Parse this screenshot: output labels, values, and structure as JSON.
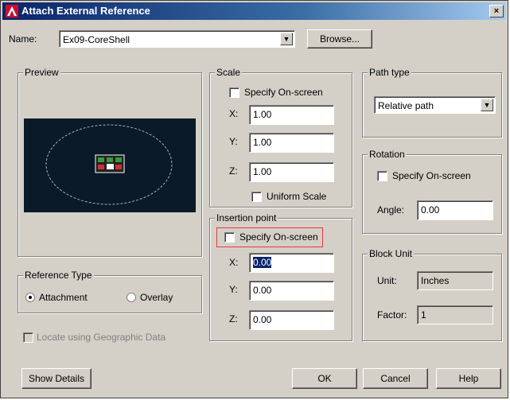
{
  "window": {
    "title": "Attach External Reference",
    "close_label": "×"
  },
  "name_row": {
    "label": "Name:",
    "value": "Ex09-CoreShell",
    "browse_label": "Browse..."
  },
  "preview": {
    "title": "Preview"
  },
  "scale": {
    "title": "Scale",
    "specify_label": "Specify On-screen",
    "x_label": "X:",
    "x_value": "1.00",
    "y_label": "Y:",
    "y_value": "1.00",
    "z_label": "Z:",
    "z_value": "1.00",
    "uniform_label": "Uniform Scale"
  },
  "insertion": {
    "title": "Insertion point",
    "specify_label": "Specify On-screen",
    "x_label": "X:",
    "x_value": "0.00",
    "y_label": "Y:",
    "y_value": "0.00",
    "z_label": "Z:",
    "z_value": "0.00"
  },
  "path_type": {
    "title": "Path type",
    "value": "Relative path"
  },
  "rotation": {
    "title": "Rotation",
    "specify_label": "Specify On-screen",
    "angle_label": "Angle:",
    "angle_value": "0.00"
  },
  "block_unit": {
    "title": "Block Unit",
    "unit_label": "Unit:",
    "unit_value": "Inches",
    "factor_label": "Factor:",
    "factor_value": "1"
  },
  "reference_type": {
    "title": "Reference Type",
    "attachment_label": "Attachment",
    "overlay_label": "Overlay",
    "selected": "Attachment"
  },
  "geo_label": "Locate using Geographic Data",
  "buttons": {
    "show_details": "Show Details",
    "ok": "OK",
    "cancel": "Cancel",
    "help": "Help"
  },
  "colors": {
    "highlight": "#e8383d",
    "title_bar": "#0a246a",
    "preview_bg": "#0a1a28"
  }
}
